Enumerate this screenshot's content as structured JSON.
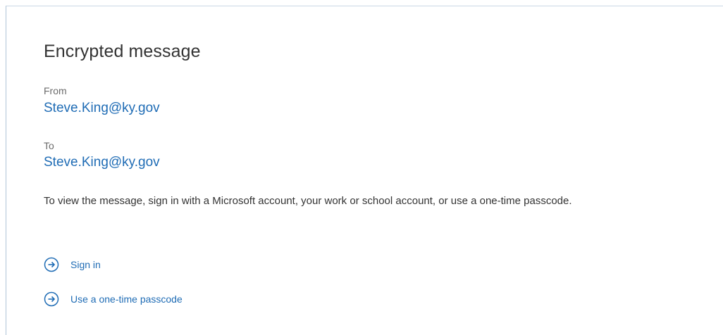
{
  "title": "Encrypted message",
  "from": {
    "label": "From",
    "value": "Steve.King@ky.gov"
  },
  "to": {
    "label": "To",
    "value": "Steve.King@ky.gov"
  },
  "instructions": "To view the message, sign in with a Microsoft account, your work or school account, or use a one-time passcode.",
  "actions": [
    {
      "label": "Sign in",
      "icon": "arrow-circle-right-icon"
    },
    {
      "label": "Use a one-time passcode",
      "icon": "arrow-circle-right-icon"
    }
  ],
  "colors": {
    "link": "#1f6cb5",
    "text": "#333333",
    "muted": "#6b6b6b",
    "border": "#aec3d6"
  }
}
